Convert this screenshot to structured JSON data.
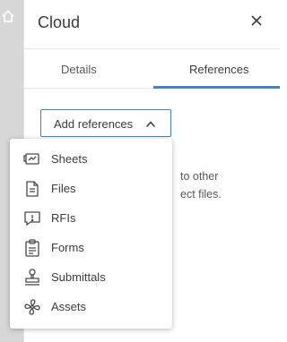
{
  "panel": {
    "title": "Cloud"
  },
  "tabs": [
    {
      "label": "Details"
    },
    {
      "label": "References"
    }
  ],
  "add_button": {
    "label": "Add references"
  },
  "background_text": {
    "line1": "to other",
    "line2": "ect files."
  },
  "menu": {
    "items": [
      {
        "label": "Sheets",
        "icon": "sheets-icon"
      },
      {
        "label": "Files",
        "icon": "file-icon"
      },
      {
        "label": "RFIs",
        "icon": "rfi-icon"
      },
      {
        "label": "Forms",
        "icon": "clipboard-icon"
      },
      {
        "label": "Submittals",
        "icon": "stamp-icon"
      },
      {
        "label": "Assets",
        "icon": "fan-icon"
      }
    ]
  },
  "colors": {
    "accent": "#3f86c2",
    "sidebar": "#d7d7d7",
    "text": "#3c3c3c"
  }
}
